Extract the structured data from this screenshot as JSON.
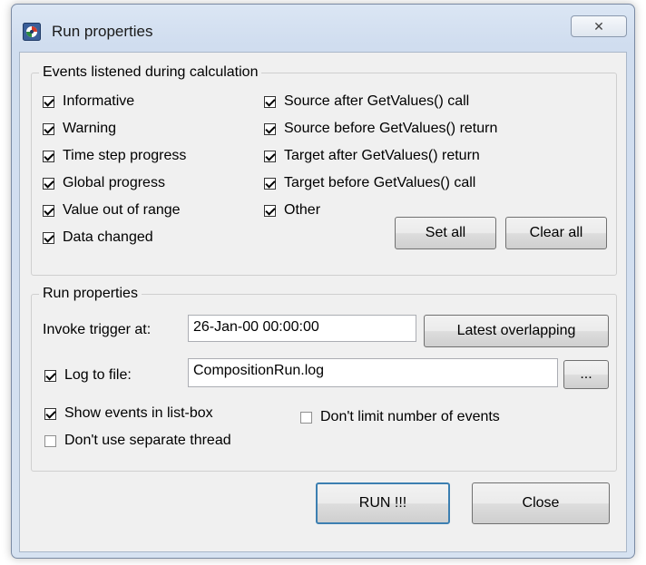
{
  "window": {
    "title": "Run properties",
    "close_glyph": "✕",
    "icon": "run-app-icon"
  },
  "events_group": {
    "legend": "Events listened during calculation",
    "col1": [
      {
        "label": "Informative",
        "checked": true
      },
      {
        "label": "Warning",
        "checked": true
      },
      {
        "label": "Time step progress",
        "checked": true
      },
      {
        "label": "Global progress",
        "checked": true
      },
      {
        "label": "Value out of range",
        "checked": true
      },
      {
        "label": "Data changed",
        "checked": true
      }
    ],
    "col2": [
      {
        "label": "Source after GetValues() call",
        "checked": true
      },
      {
        "label": "Source before GetValues() return",
        "checked": true
      },
      {
        "label": "Target after GetValues() return",
        "checked": true
      },
      {
        "label": "Target before GetValues() call",
        "checked": true
      },
      {
        "label": "Other",
        "checked": true
      }
    ],
    "set_all_label": "Set all",
    "clear_all_label": "Clear all"
  },
  "run_group": {
    "legend": "Run properties",
    "invoke_label": "Invoke trigger at:",
    "invoke_value": "26-Jan-00 00:00:00",
    "latest_label": "Latest overlapping",
    "log_label": "Log to file:",
    "log_checked": true,
    "log_value": "CompositionRun.log",
    "browse_label": "...",
    "show_events_label": "Show events in list-box",
    "show_events_checked": true,
    "dont_limit_label": "Don't limit number of events",
    "dont_limit_checked": false,
    "dont_separate_label": "Don't use separate thread",
    "dont_separate_checked": false
  },
  "buttons": {
    "run_label": "RUN !!!",
    "close_label": "Close"
  }
}
